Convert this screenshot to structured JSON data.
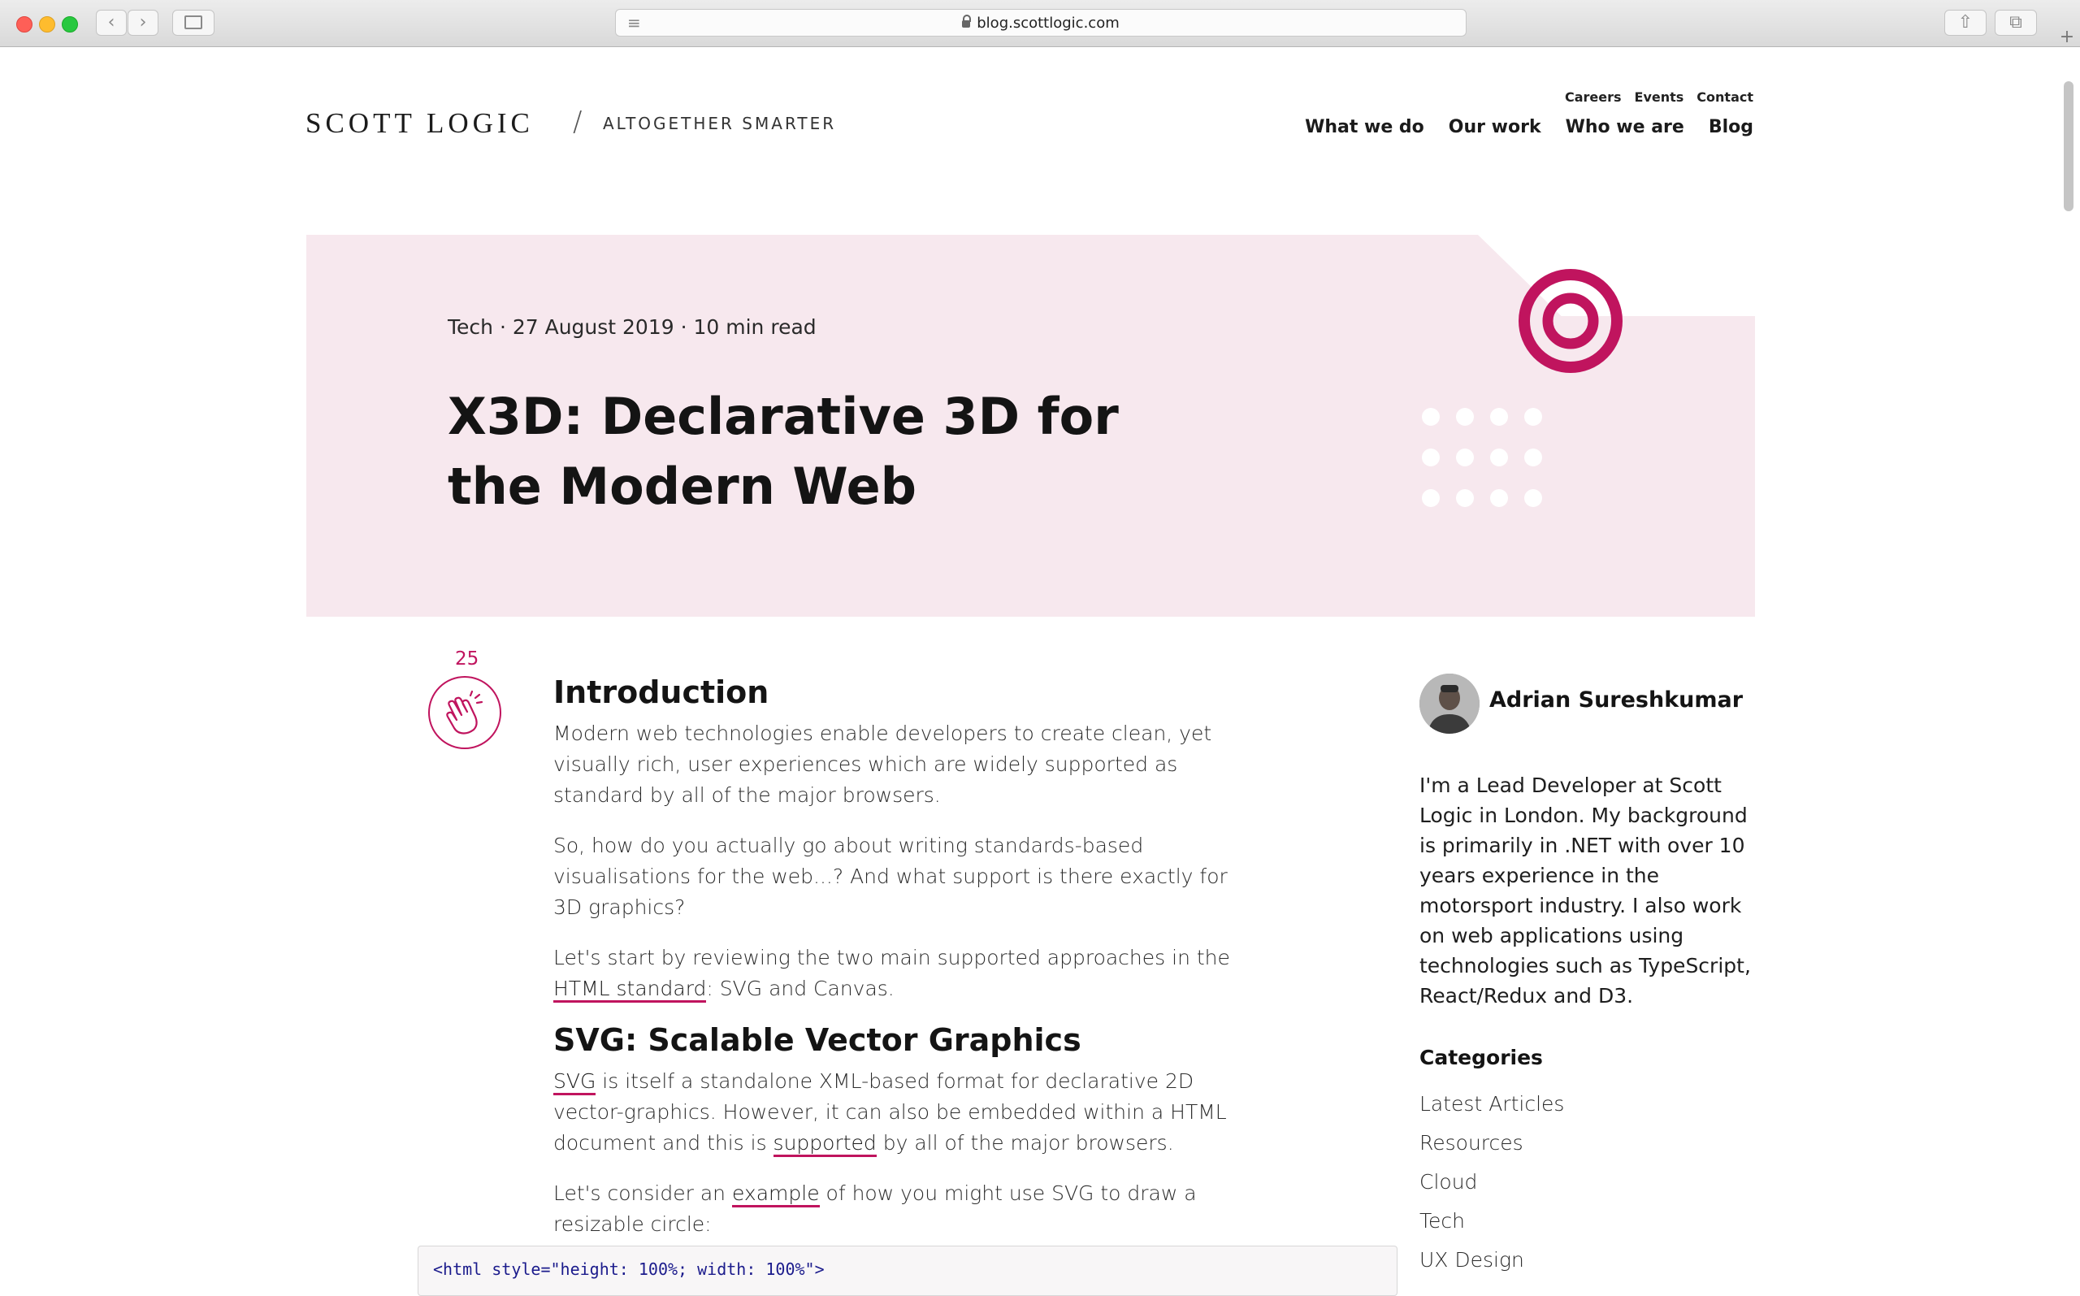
{
  "browser": {
    "url": "blog.scottlogic.com",
    "new_tab_symbol": "+"
  },
  "header": {
    "logo": "SCOTT LOGIC",
    "separator": "/",
    "tagline": "ALTOGETHER SMARTER",
    "top_nav": [
      "Careers",
      "Events",
      "Contact"
    ],
    "main_nav": [
      "What we do",
      "Our work",
      "Who we are",
      "Blog"
    ]
  },
  "hero": {
    "meta": "Tech · 27 August 2019 · 10 min read",
    "title": "X3D: Declarative 3D for the Modern Web",
    "accent_color": "#c0145e",
    "background_color": "#f7e8ee"
  },
  "clap": {
    "count": "25",
    "icon": "clap-icon"
  },
  "article": {
    "h_intro": "Introduction",
    "p1": "Modern web technologies enable developers to create clean, yet visually rich, user experiences which are widely supported as standard by all of the major browsers.",
    "p2": "So, how do you actually go about writing standards-based visualisations for the web...? And what support is there exactly for 3D graphics?",
    "p3_pre": "Let's start by reviewing the two main supported approaches in the ",
    "p3_link": "HTML standard",
    "p3_post": ": SVG and Canvas.",
    "h_svg": "SVG: Scalable Vector Graphics",
    "p4_link1": "SVG",
    "p4_mid": " is itself a standalone XML-based format for declarative 2D vector-graphics. However, it can also be embedded within a HTML document and this is ",
    "p4_link2": "supported",
    "p4_post": " by all of the major browsers.",
    "p5_pre": "Let's consider an ",
    "p5_link": "example",
    "p5_post": " of how you might use SVG to draw a resizable circle:",
    "code_line": "<html style=\"height: 100%; width: 100%\">"
  },
  "sidebar": {
    "author": "Adrian Sureshkumar",
    "bio": "I'm a Lead Developer at Scott Logic in London. My background is primarily in .NET with over 10 years experience in the motorsport industry. I also work on web applications using technologies such as TypeScript, React/Redux and D3.",
    "categories_title": "Categories",
    "categories": [
      "Latest Articles",
      "Resources",
      "Cloud",
      "Tech",
      "UX Design"
    ]
  }
}
